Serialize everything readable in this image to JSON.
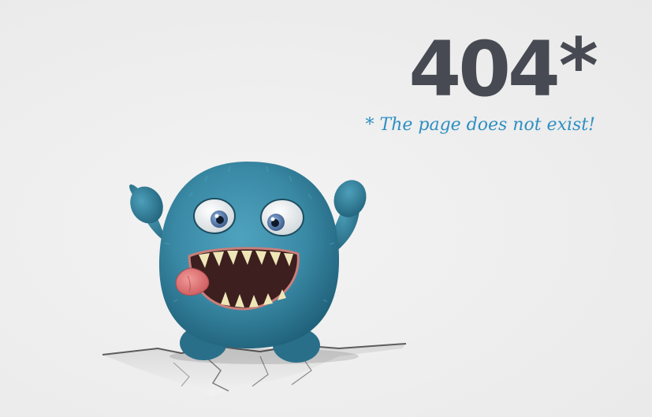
{
  "error": {
    "code": "404",
    "marker": "*",
    "message": "* The page does not exist!"
  },
  "illustration": {
    "subject": "blue-furry-monster",
    "colors": {
      "fur": "#3a8aa6",
      "fur_dark": "#246a85",
      "mouth": "#3c1f1e",
      "tongue": "#e27b7b",
      "code_text": "#474a52",
      "message_text": "#2f8fc2",
      "background": "#efefef"
    }
  }
}
